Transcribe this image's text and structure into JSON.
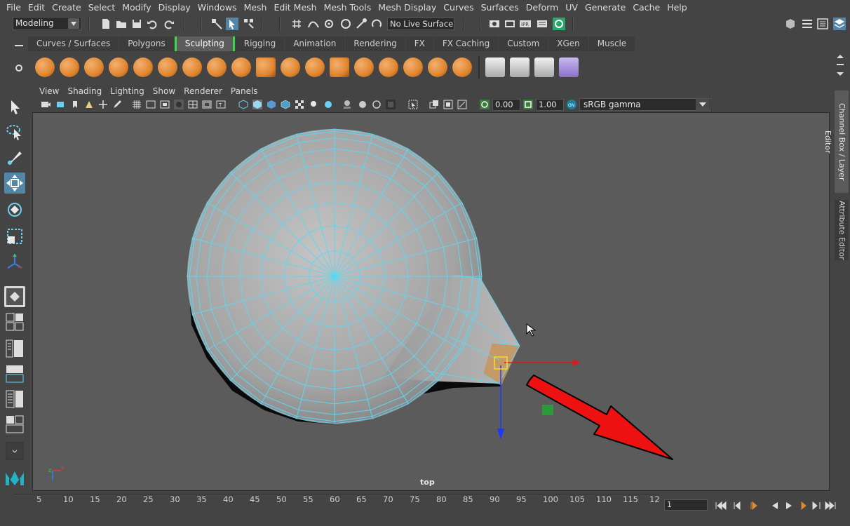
{
  "menubar": {
    "items": [
      "File",
      "Edit",
      "Create",
      "Select",
      "Modify",
      "Display",
      "Windows",
      "Mesh",
      "Edit Mesh",
      "Mesh Tools",
      "Mesh Display",
      "Curves",
      "Surfaces",
      "Deform",
      "UV",
      "Generate",
      "Cache",
      "Help"
    ]
  },
  "statusline": {
    "mode": "Modeling",
    "live_surface": "No Live Surface"
  },
  "shelf": {
    "tabs": [
      "Curves / Surfaces",
      "Polygons",
      "Sculpting",
      "Rigging",
      "Animation",
      "Rendering",
      "FX",
      "FX Caching",
      "Custom",
      "XGen",
      "Muscle"
    ],
    "active_tab": "Sculpting"
  },
  "panel": {
    "menus": [
      "View",
      "Shading",
      "Lighting",
      "Show",
      "Renderer",
      "Panels"
    ],
    "exposure": "0.00",
    "gamma": "1.00",
    "color_space": "sRGB gamma",
    "camera": "top"
  },
  "side_tabs": {
    "channel_box": "Channel Box / Layer Editor",
    "attribute_editor": "Attribute Editor"
  },
  "timeline": {
    "ticks": [
      "5",
      "10",
      "15",
      "20",
      "25",
      "30",
      "35",
      "40",
      "45",
      "50",
      "55",
      "60",
      "65",
      "70",
      "75",
      "80",
      "85",
      "90",
      "95",
      "100",
      "105",
      "110",
      "115",
      "12"
    ],
    "current_frame": "1"
  },
  "colors": {
    "wire": "#5fd6f0",
    "accent": "#5285a6",
    "shelf_active": "#3fd64a",
    "manip_x": "#e01818",
    "manip_y": "#1a3aff",
    "annotation_arrow": "#ee1111"
  }
}
